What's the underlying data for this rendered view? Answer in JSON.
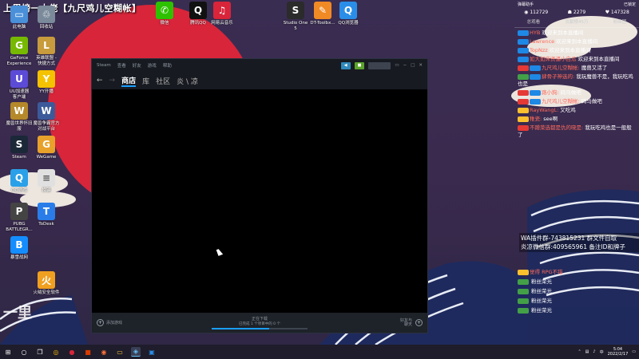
{
  "stream": {
    "title": "上周榜一大佬【九尺鸡儿空糊帐】"
  },
  "desktop_icons": [
    {
      "label": "此电脑",
      "icon": "computer-icon",
      "color": "#4a90d9"
    },
    {
      "label": "回收站",
      "icon": "recycle-bin-icon",
      "color": "#7a8a9a"
    },
    {
      "label": "GeForce\nExperience",
      "icon": "geforce-icon",
      "color": "#76b900"
    },
    {
      "label": "英雄联盟 -\n快捷方式",
      "icon": "lol-icon",
      "color": "#c89b3c"
    },
    {
      "label": "UU加速器\n客户端",
      "icon": "uu-icon",
      "color": "#5b4bd6"
    },
    {
      "label": "YY开播",
      "icon": "yy-icon",
      "color": "#f5c200"
    },
    {
      "label": "魔兽世界怀旧\n服",
      "icon": "wow-icon",
      "color": "#b5892a"
    },
    {
      "label": "魔兽争霸官方\n对战平台",
      "icon": "warcraft-icon",
      "color": "#3c5a9a"
    },
    {
      "label": "Steam",
      "icon": "steam-icon",
      "color": "#1b2838"
    },
    {
      "label": "WeGame",
      "icon": "wegame-icon",
      "color": "#e8a12a"
    },
    {
      "label": "QQ游戏",
      "icon": "qqgame-icon",
      "color": "#2aa0e8"
    },
    {
      "label": "换键",
      "icon": "file-icon",
      "color": "#e0e0e0"
    },
    {
      "label": "PUBG\nBATTLEGR...",
      "icon": "pubg-icon",
      "color": "#444"
    },
    {
      "label": "ToDesk",
      "icon": "todesk-icon",
      "color": "#2a7de8"
    },
    {
      "label": "暴雪战网",
      "icon": "battlenet-icon",
      "color": "#148eff"
    },
    {
      "label": "火绒安全软件",
      "icon": "huorong-icon",
      "color": "#f0a020"
    }
  ],
  "top_icons": [
    {
      "label": "微信",
      "icon": "wechat-icon",
      "color": "#2dc100"
    },
    {
      "label": "腾讯QQ",
      "icon": "qq-icon",
      "color": "#111"
    },
    {
      "label": "网易云音乐",
      "icon": "netease-music-icon",
      "color": "#d8253a"
    },
    {
      "label": "Studio One\n5",
      "icon": "studio-one-icon",
      "color": "#2b2b2b"
    },
    {
      "label": "DT-Toolbx...",
      "icon": "toolbox-icon",
      "color": "#f08a24"
    },
    {
      "label": "QQ浏览器",
      "icon": "qq-browser-icon",
      "color": "#2a8ee8"
    }
  ],
  "steam": {
    "menu": [
      "Steam",
      "查看",
      "好友",
      "游戏",
      "帮助"
    ],
    "nav": {
      "store": "商店",
      "library": "库",
      "community": "社区",
      "user": "炎 \\ 凉"
    },
    "footer": {
      "add_game": "添加游戏",
      "download_status": "正在下载",
      "download_detail": "已完成 1 个项目中的 0 个",
      "progress": 0.6,
      "friends": "好友与\n聊天"
    }
  },
  "panel": {
    "top_left": "弹幕助手",
    "top_right": "已锁定",
    "stats": [
      "112729",
      "2279",
      "147328"
    ],
    "tabs": [
      "总观看",
      "贡献榜45万",
      "粉丝团"
    ],
    "messages": [
      {
        "badges": [
          "#1e88e5"
        ],
        "user": "HYB",
        "text": "欢迎来到本直播间"
      },
      {
        "badges": [
          "#1e88e5"
        ],
        "user": "Lawrence",
        "text": "欢迎来到本直播间"
      },
      {
        "badges": [
          "#1e88e5"
        ],
        "user": "TopNzz",
        "text": "欢迎来到本直播间"
      },
      {
        "badges": [
          "#1e88e5"
        ],
        "user": "如大如床贤逼小白瓜",
        "text": "欢迎来到本直播间"
      },
      {
        "badges": [
          "#e53935",
          "#1e88e5"
        ],
        "user": "九尺鸡儿空糊帐:",
        "text": "魔兽又活了"
      },
      {
        "badges": [
          "#43a047",
          "#1e88e5"
        ],
        "user": "肆骨孑神选的:",
        "text": "我玩魔兽不是，我玩吃鸡也是"
      },
      {
        "badges": [
          "#e53935",
          "#1e88e5"
        ],
        "user": "路小狗:",
        "text": "码马做吧"
      },
      {
        "badges": [
          "#e53935",
          "#1e88e5"
        ],
        "user": "九尺鸡儿空糊帐:",
        "text": "码马做吧"
      },
      {
        "badges": [
          "#fbc02d"
        ],
        "user": "RayWangL:",
        "text": "又吃鸡"
      },
      {
        "badges": [
          "#fbc02d"
        ],
        "user": "稚瓷:",
        "text": "see啊"
      },
      {
        "badges": [
          "#e53935"
        ],
        "user": "不蹭菜选都是仇的晓是:",
        "text": "我玩吃鸡也是一般般了"
      }
    ],
    "messages_lower": [
      {
        "badges": [
          "#fbc02d"
        ],
        "user": "觉得 RPG不错",
        "text": ""
      },
      {
        "badges": [
          "#43a047"
        ],
        "user": "",
        "text": "粉丝荣光"
      },
      {
        "badges": [
          "#43a047"
        ],
        "user": "",
        "text": "粉丝荣光"
      },
      {
        "badges": [
          "#43a047"
        ],
        "user": "",
        "text": "粉丝荣光"
      },
      {
        "badges": [
          "#43a047"
        ],
        "user": "",
        "text": "粉丝荣光"
      }
    ],
    "overlay": [
      "WA插件群-743815231 群文件自取",
      "炎凉微信群:409565961 备注ID和牌子"
    ]
  },
  "logo_lowerleft": "一里",
  "taskbar": {
    "time": "5:04",
    "date": "2022/2/17",
    "input_method": "中",
    "icons": [
      "windows-start-icon",
      "search-icon",
      "task-view-icon",
      "chrome-icon",
      "netease-icon",
      "office-icon",
      "firefox-icon",
      "explorer-icon",
      "steam-icon",
      "remote-icon"
    ]
  }
}
